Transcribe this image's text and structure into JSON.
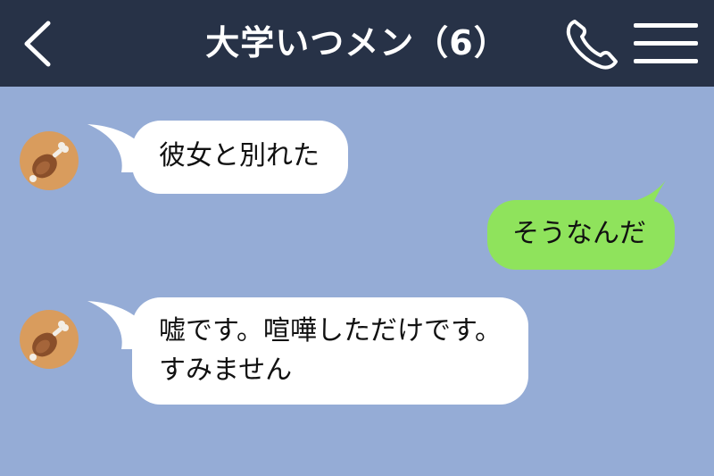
{
  "header": {
    "title": "大学いつメン（6）",
    "back_icon": "chevron-left-icon",
    "call_icon": "phone-icon",
    "menu_icon": "hamburger-menu-icon"
  },
  "colors": {
    "header_bg": "#273247",
    "chat_bg": "#95acd6",
    "incoming_bubble": "#ffffff",
    "outgoing_bubble": "#8fe35c",
    "avatar_bg": "#d99c5d"
  },
  "messages": [
    {
      "side": "incoming",
      "avatar_icon": "meat-on-bone-icon",
      "lines": [
        "彼女と別れた"
      ]
    },
    {
      "side": "outgoing",
      "lines": [
        "そうなんだ"
      ]
    },
    {
      "side": "incoming",
      "avatar_icon": "meat-on-bone-icon",
      "lines": [
        "嘘です。喧嘩しただけです。",
        "すみません"
      ]
    }
  ]
}
